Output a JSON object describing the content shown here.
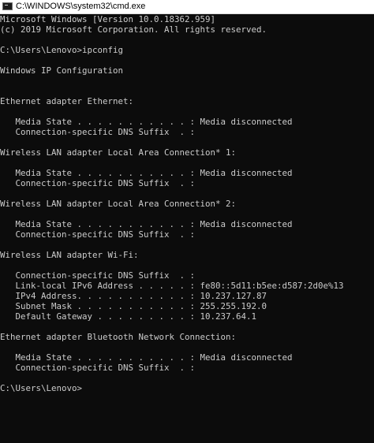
{
  "window": {
    "title": "C:\\WINDOWS\\system32\\cmd.exe"
  },
  "console": {
    "lines": [
      "Microsoft Windows [Version 10.0.18362.959]",
      "(c) 2019 Microsoft Corporation. All rights reserved.",
      "",
      "C:\\Users\\Lenovo>ipconfig",
      "",
      "Windows IP Configuration",
      "",
      "",
      "Ethernet adapter Ethernet:",
      "",
      "   Media State . . . . . . . . . . . : Media disconnected",
      "   Connection-specific DNS Suffix  . :",
      "",
      "Wireless LAN adapter Local Area Connection* 1:",
      "",
      "   Media State . . . . . . . . . . . : Media disconnected",
      "   Connection-specific DNS Suffix  . :",
      "",
      "Wireless LAN adapter Local Area Connection* 2:",
      "",
      "   Media State . . . . . . . . . . . : Media disconnected",
      "   Connection-specific DNS Suffix  . :",
      "",
      "Wireless LAN adapter Wi-Fi:",
      "",
      "   Connection-specific DNS Suffix  . :",
      "   Link-local IPv6 Address . . . . . : fe80::5d11:b5ee:d587:2d0e%13",
      "   IPv4 Address. . . . . . . . . . . : 10.237.127.87",
      "   Subnet Mask . . . . . . . . . . . : 255.255.192.0",
      "   Default Gateway . . . . . . . . . : 10.237.64.1",
      "",
      "Ethernet adapter Bluetooth Network Connection:",
      "",
      "   Media State . . . . . . . . . . . : Media disconnected",
      "   Connection-specific DNS Suffix  . :",
      "",
      "C:\\Users\\Lenovo>"
    ]
  }
}
